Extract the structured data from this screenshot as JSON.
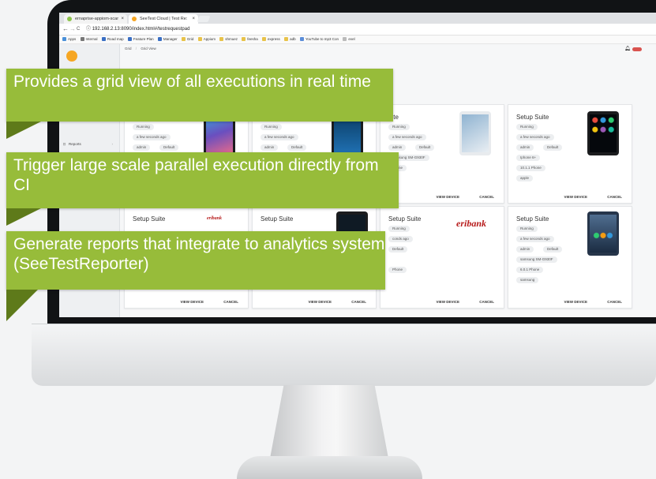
{
  "browser": {
    "tabs": [
      {
        "label": "ernaprise-appiom-scar",
        "close": "×"
      },
      {
        "label": "SeeTest Cloud | Test Re:",
        "close": "×"
      }
    ],
    "nav": {
      "back": "←",
      "forward": "→",
      "reload": "C",
      "info": "ⓘ"
    },
    "url": "192.168.2.13:8090/index.html#/testrequestpad",
    "bookmarks": [
      "Apps",
      "Internal",
      "Road map",
      "Feature Plan",
      "Manager",
      "Grid",
      "Appium",
      "shmuez",
      "feesha",
      "express",
      "adb",
      "YouTube to mp3 Con",
      "evel"
    ]
  },
  "app": {
    "breadcrumb": {
      "first": "Grid",
      "second": "Grid View"
    },
    "sidebar": [
      {
        "icon": "⊡",
        "label": "Reports"
      },
      {
        "icon": "⚙",
        "label": "Sensorimotor"
      }
    ],
    "cards_top": [
      {
        "title": "",
        "status": "Running",
        "time": "a few seconds ago",
        "user": "admin",
        "project": "Default",
        "device": "",
        "os": "",
        "manufacturer": "",
        "view": "",
        "cancel": ""
      },
      {
        "title": "",
        "status": "Running",
        "time": "a few seconds ago",
        "user": "admin",
        "project": "Default",
        "device": "",
        "os": "",
        "manufacturer": "",
        "view": "",
        "cancel": ""
      },
      {
        "title": "uite",
        "status": "Running",
        "time": "a few seconds ago",
        "user": "admin",
        "project": "Default",
        "device": "samsung SM-G930F",
        "os": "Phone",
        "manufacturer": "",
        "view": "VIEW DEVICE",
        "cancel": "CANCEL"
      },
      {
        "title": "Setup Suite",
        "status": "Running",
        "time": "a few seconds ago",
        "user": "admin",
        "project": "Default",
        "device": "Iphone 6+",
        "os": "10.1.1   Phone",
        "manufacturer": "apple",
        "view": "VIEW DEVICE",
        "cancel": "CANCEL"
      }
    ],
    "cards_bottom": [
      {
        "title": "Setup Suite",
        "status": "",
        "time": "",
        "user": "",
        "project": "",
        "device": "",
        "os": "",
        "manufacturer": "",
        "view": "VIEW DEVICE",
        "cancel": "CANCEL",
        "brand": "eribank"
      },
      {
        "title": "Setup Suite",
        "status": "",
        "time": "",
        "user": "",
        "project": "",
        "device": "",
        "os": "",
        "manufacturer": "",
        "view": "VIEW DEVICE",
        "cancel": "CANCEL",
        "brand": ""
      },
      {
        "title": "Setup Suite",
        "status": "Running",
        "time": "conds ago",
        "user": "",
        "project": "Default",
        "device": "",
        "os": "Phone",
        "manufacturer": "",
        "view": "VIEW DEVICE",
        "cancel": "CANCEL",
        "brand": "eribank"
      },
      {
        "title": "Setup Suite",
        "status": "Running",
        "time": "a few seconds ago",
        "user": "admin",
        "project": "Default",
        "device": "samsung SM-G930F",
        "os": "6.0.1   Phone",
        "manufacturer": "samsung",
        "view": "VIEW DEVICE",
        "cancel": "CANCEL",
        "brand": ""
      }
    ]
  },
  "callouts": [
    {
      "text": "Provides a grid view of all executions in real time"
    },
    {
      "text": "Trigger large scale parallel execution directly from CI"
    },
    {
      "text": "Generate reports that integrate to analytics system (SeeTestReporter)"
    }
  ],
  "colors": {
    "callout": "#97bc3a",
    "callout_tail": "#5e7a1a",
    "accent_red": "#d9534f"
  }
}
